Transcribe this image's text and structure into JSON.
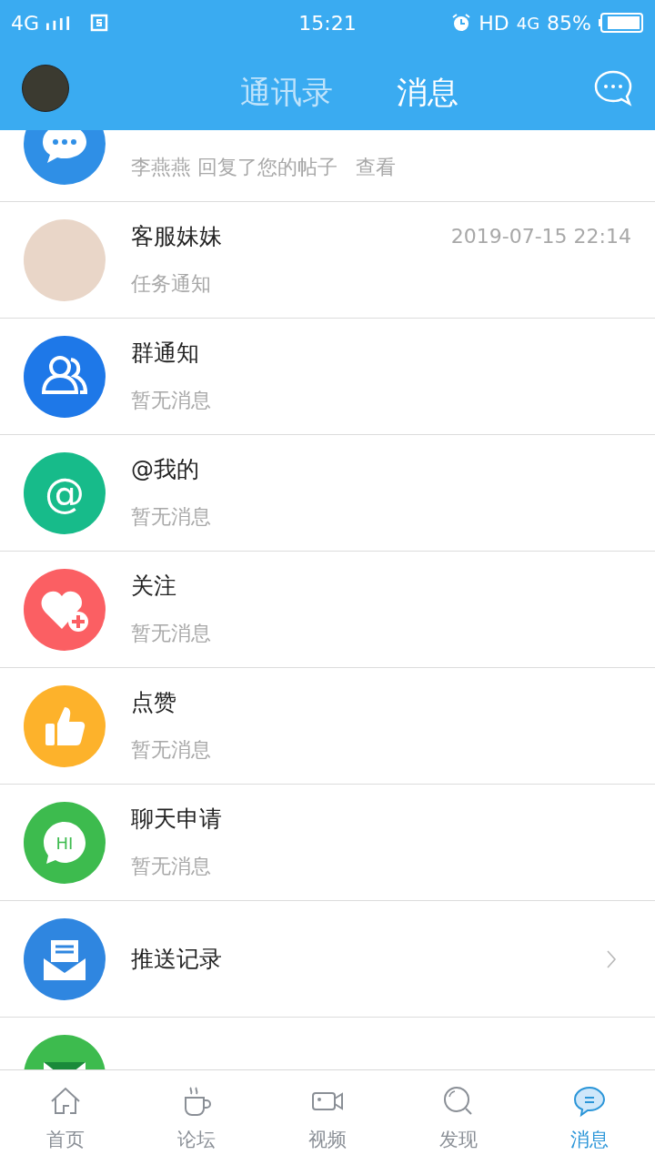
{
  "status_bar": {
    "network": "4G",
    "time": "15:21",
    "hd": "HD",
    "data": "4G",
    "battery": "85%"
  },
  "header": {
    "tabs": [
      {
        "label": "通讯录",
        "selected": false
      },
      {
        "label": "消息",
        "selected": true
      }
    ]
  },
  "messages": [
    {
      "kind": "chat",
      "color": "#2f8fe6",
      "subtitle": "李燕燕 回复了您的帖子",
      "action": "查看"
    },
    {
      "kind": "photo",
      "title": "客服妹妹",
      "time": "2019-07-15 22:14",
      "subtitle": "任务通知"
    },
    {
      "kind": "group",
      "color": "#1e78e8",
      "title": "群通知",
      "subtitle": "暂无消息"
    },
    {
      "kind": "at",
      "color": "#17bb8a",
      "icon_text": "@",
      "title": "@我的",
      "subtitle": "暂无消息"
    },
    {
      "kind": "heart",
      "color": "#fb5f63",
      "title": "关注",
      "subtitle": "暂无消息"
    },
    {
      "kind": "thumb",
      "color": "#fdb22b",
      "title": "点赞",
      "subtitle": "暂无消息"
    },
    {
      "kind": "hi",
      "color": "#3dbb4e",
      "icon_text": "HI",
      "title": "聊天申请",
      "subtitle": "暂无消息"
    }
  ],
  "links": [
    {
      "kind": "mail",
      "color": "#2f86e0",
      "title": "推送记录"
    },
    {
      "kind": "envelope",
      "color": "#3dbb4e"
    }
  ],
  "bottom_nav": [
    {
      "kind": "home",
      "label": "首页",
      "selected": false
    },
    {
      "kind": "cup",
      "label": "论坛",
      "selected": false
    },
    {
      "kind": "video",
      "label": "视频",
      "selected": false
    },
    {
      "kind": "search",
      "label": "发现",
      "selected": false
    },
    {
      "kind": "message",
      "label": "消息",
      "selected": true
    }
  ]
}
